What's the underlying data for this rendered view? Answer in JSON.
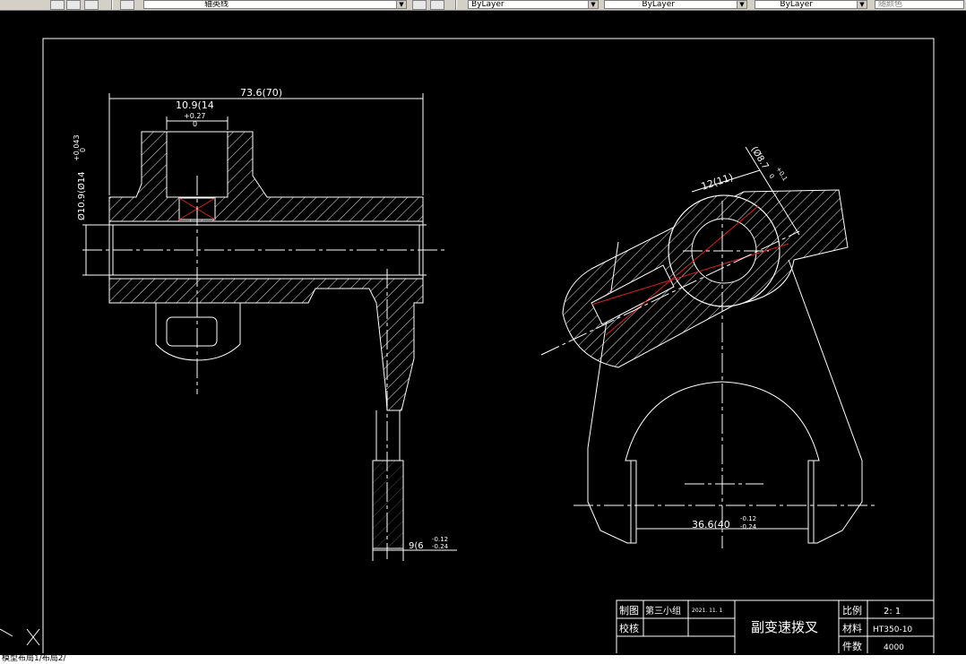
{
  "toolbar": {
    "layer_name": "轴英线",
    "color_combo": "ByLayer",
    "linetype_combo": "ByLayer",
    "lineweight_combo": "ByLayer",
    "plotstyle_combo": "随颜色"
  },
  "drawing": {
    "dim_overall": "73.6(70)",
    "dim_slot": "10.9(14",
    "dim_slot_tol_upper": "+0.27",
    "dim_slot_tol_lower": "0",
    "dim_bore": "Ø10.9(Ø14",
    "dim_bore_tol_upper": "+0.043",
    "dim_bore_tol_lower": "0",
    "dim_fork_width_main": "9(6",
    "dim_fork_width_upper": "-0.12",
    "dim_fork_width_lower": "-0.24",
    "dim_arm_length": "12(11)",
    "dim_pin_diam": "(Ø8.7",
    "dim_pin_tol_upper": "+0.1",
    "dim_pin_tol_lower": "0",
    "dim_fork_gap_main": "36.6(40",
    "dim_fork_gap_upper": "-0.12",
    "dim_fork_gap_lower": "-0.24"
  },
  "title_block": {
    "drawn_label": "制图",
    "drawn_by": "第三小组",
    "date": "2021. 11. 1",
    "checked_label": "校核",
    "part_name": "副变速拨叉",
    "scale_label": "比例",
    "scale_value": "2: 1",
    "material_label": "材料",
    "material_value": "HT350-10",
    "qty_label": "件数",
    "qty_value": "4000"
  },
  "command_line": {
    "text": "模型布局1/布局2/"
  },
  "ucs_icon": "ucs-icon"
}
